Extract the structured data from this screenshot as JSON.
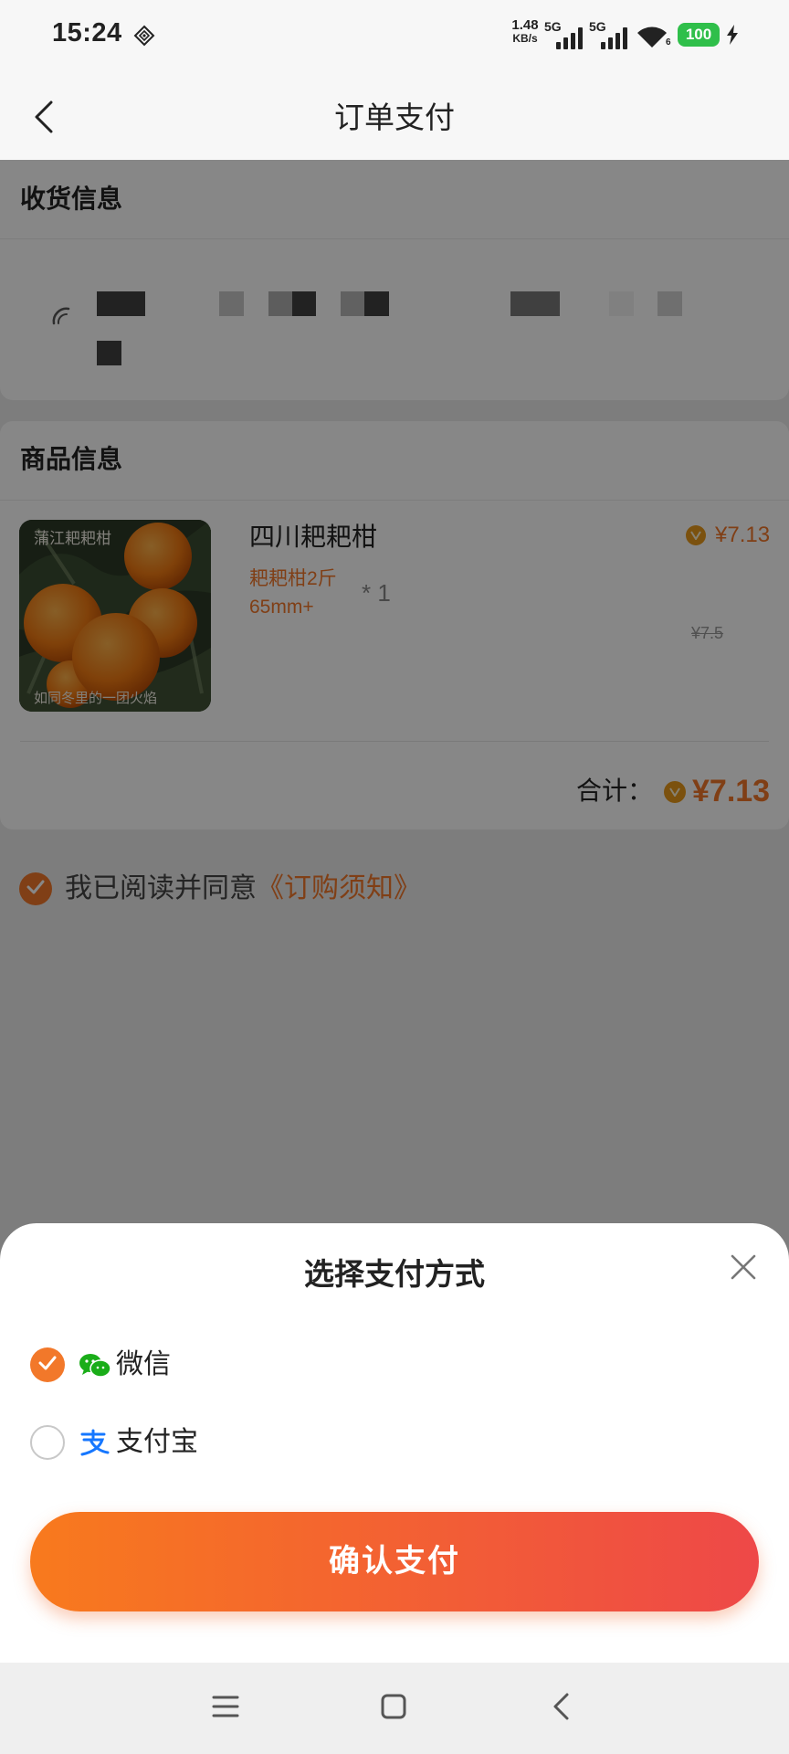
{
  "status_bar": {
    "time": "15:24",
    "net_speed_value": "1.48",
    "net_speed_unit": "KB/s",
    "sim1_label": "5G",
    "sim2_label": "5G",
    "wifi_badge": "6",
    "battery_level": "100",
    "icons": [
      "nfc-diamond-icon",
      "signal-icon",
      "signal-icon",
      "wifi-icon",
      "battery-icon",
      "charging-icon"
    ]
  },
  "header": {
    "title": "订单支付",
    "back_icon": "chevron-left-icon"
  },
  "shipping": {
    "title": "收货信息",
    "address_redacted": true
  },
  "product_section": {
    "title": "商品信息",
    "product": {
      "name": "四川耙耙柑",
      "spec_line1": "耙耙柑2斤",
      "spec_line2": "65mm+",
      "quantity": "* 1",
      "price": "¥7.13",
      "original_price": "¥7.5",
      "image_watermark_top": "蒲江耙耙柑",
      "image_watermark_bottom": "如同冬里的一团火焰"
    },
    "total_label": "合计：",
    "total_value": "¥7.13"
  },
  "agreement": {
    "checked": true,
    "text": "我已阅读并同意",
    "link": "《订购须知》"
  },
  "payment_sheet": {
    "title": "选择支付方式",
    "options": [
      {
        "label": "微信",
        "icon": "wechat-icon",
        "selected": true
      },
      {
        "label": "支付宝",
        "icon": "alipay-icon",
        "selected": false
      }
    ],
    "confirm_label": "确认支付"
  },
  "nav_bar": {
    "icons": [
      "menu-icon",
      "home-square-icon",
      "back-icon"
    ]
  },
  "colors": {
    "accent": "#f2782a",
    "btn_start": "#f87a1d",
    "btn_end": "#ee4848",
    "battery": "#2fbf4a",
    "wechat": "#1aad19",
    "alipay": "#1677ff"
  }
}
